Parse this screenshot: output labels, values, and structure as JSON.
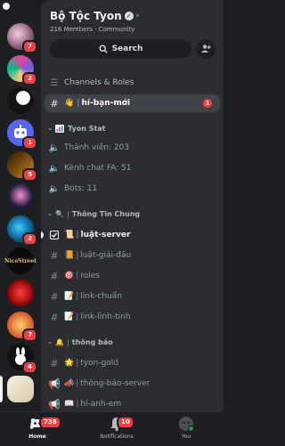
{
  "server": {
    "name": "Bộ Tộc Tyon",
    "member_count": "216 Members",
    "separator": "·",
    "type": "Community"
  },
  "search": {
    "label": "Search"
  },
  "channels_roles": {
    "label": "Channels & Roles"
  },
  "channels": {
    "hi_ban_moi": {
      "emoji": "👋",
      "label": "hí-bạn-mới",
      "badge": "1"
    },
    "tyon_stat": {
      "category": "Tyon Stat",
      "members": "Thành viên: 203",
      "fa_channels": "Kênh chat FA: 51",
      "bots": "Bots: 11"
    },
    "thong_tin_chung": {
      "category": "Thông Tin Chung",
      "luat_server": {
        "emoji": "📜",
        "label": "luật-server"
      },
      "luat_giai_dau": {
        "emoji": "📙",
        "label": "luật-giải-đấu"
      },
      "roles": {
        "emoji": "🎯",
        "label": "roles"
      },
      "link_chuan": {
        "emoji": "📝",
        "label": "link-chuẩn"
      },
      "link_linh_tinh": {
        "emoji": "📝",
        "label": "link-lình-tinh"
      }
    },
    "thong_bao": {
      "category": "thông báo",
      "tyon_gold": {
        "emoji": "🌟",
        "label": "tyon-gold"
      },
      "thong_bao_server": {
        "emoji": "📣",
        "label": "thông-báo-server"
      },
      "hi_anh_em": {
        "emoji": "📖",
        "label": "hí-anh-em"
      }
    }
  },
  "server_list": {
    "badges": [
      "7",
      "2",
      "1",
      "5",
      "2",
      "7",
      "4"
    ],
    "text_server": "NiceStreet"
  },
  "bottom_nav": {
    "home": {
      "label": "Home",
      "badge": "738"
    },
    "notifications": {
      "label": "Notifications",
      "badge": "10"
    },
    "you": {
      "label": "You"
    }
  },
  "colors": {
    "background": "#1e1f22",
    "panel": "#2b2d31",
    "selected": "#404249",
    "badge": "#f23f43",
    "online": "#23a55a"
  }
}
